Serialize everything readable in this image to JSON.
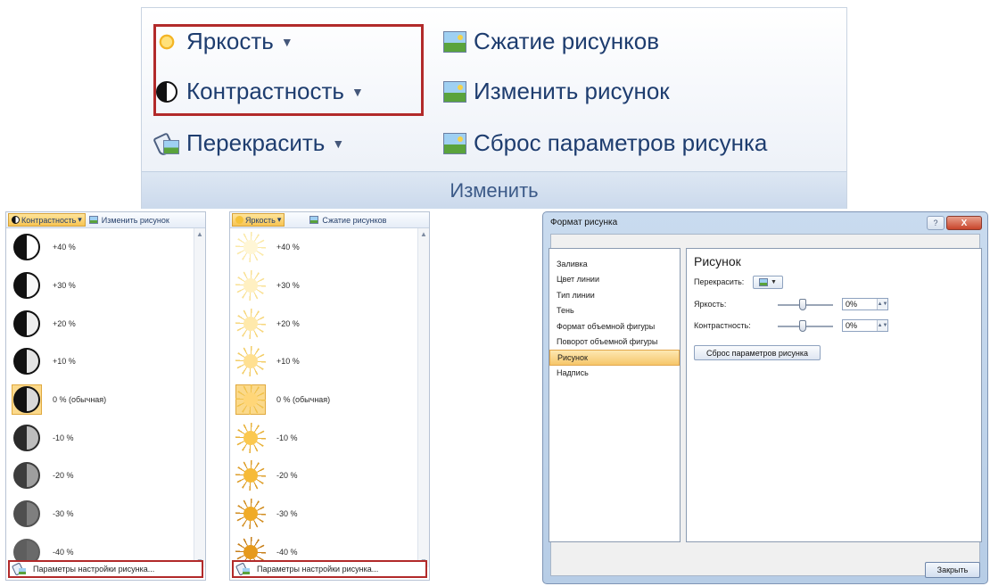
{
  "ribbon": {
    "brightness": "Яркость",
    "contrast": "Контрастность",
    "recolor": "Перекрасить",
    "compress": "Сжатие рисунков",
    "change_picture": "Изменить рисунок",
    "reset_picture": "Сброс параметров рисунка",
    "group_label": "Изменить",
    "dropdown_arrow": "▼"
  },
  "contrast_gallery": {
    "header_chip": "Контрастность",
    "header_other": "Изменить рисунок",
    "items": [
      "+40 %",
      "+30 %",
      "+20 %",
      "+10 %",
      "0 % (обычная)",
      "-10 %",
      "-20 %",
      "-30 %",
      "-40 %"
    ],
    "footer": "Параметры настройки рисунка..."
  },
  "brightness_gallery": {
    "header_chip": "Яркость",
    "header_other": "Сжатие рисунков",
    "items": [
      "+40 %",
      "+30 %",
      "+20 %",
      "+10 %",
      "0 % (обычная)",
      "-10 %",
      "-20 %",
      "-30 %",
      "-40 %"
    ],
    "footer": "Параметры настройки рисунка..."
  },
  "dialog": {
    "title": "Формат рисунка",
    "help": "?",
    "close_x": "X",
    "nav": [
      "Заливка",
      "Цвет линии",
      "Тип линии",
      "Тень",
      "Формат объемной фигуры",
      "Поворот объемной фигуры",
      "Рисунок",
      "Надпись"
    ],
    "active_nav": "Рисунок",
    "panel_title": "Рисунок",
    "recolor_label": "Перекрасить:",
    "brightness_label": "Яркость:",
    "brightness_value": "0%",
    "contrast_label": "Контрастность:",
    "contrast_value": "0%",
    "reset_button": "Сброс параметров рисунка",
    "close_button": "Закрыть"
  },
  "colors": {
    "highlight": "#b22a2a",
    "selected_item": "#fbd98b",
    "ribbon_text": "#1e3d6f"
  }
}
